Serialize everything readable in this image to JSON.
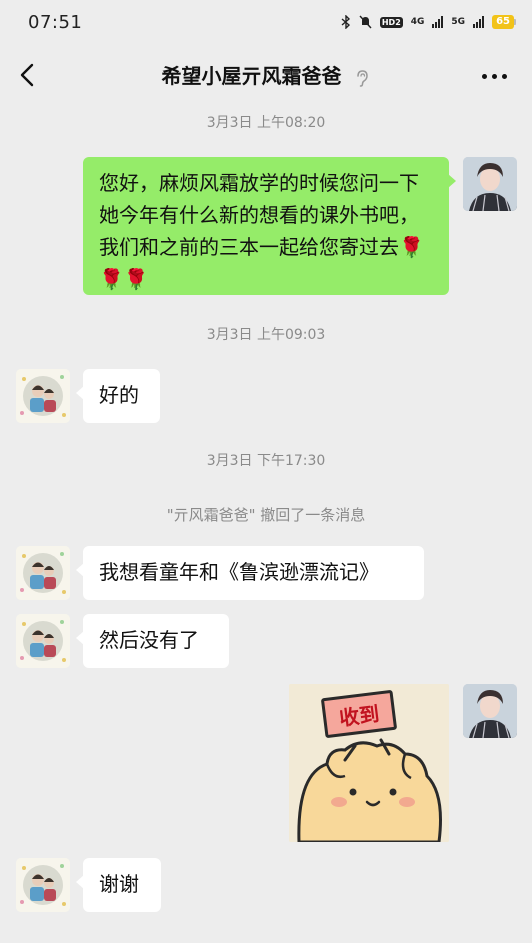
{
  "status_bar": {
    "time": "07:51",
    "network_hd": "HD2",
    "net1": "4G",
    "net2": "5G",
    "battery": "65"
  },
  "nav": {
    "title": "希望小屋亓风霜爸爸"
  },
  "messages": {
    "ts1": "3月3日 上午08:20",
    "msg1": "您好，麻烦风霜放学的时候您问一下她今年有什么新的想看的课外书吧，我们和之前的三本一起给您寄过去🌹🌹🌹",
    "ts2": "3月3日 上午09:03",
    "msg2": "好的",
    "ts3": "3月3日 下午17:30",
    "recall": "\"亓风霜爸爸\" 撤回了一条消息",
    "msg3": "我想看童年和《鲁滨逊漂流记》",
    "msg4": "然后没有了",
    "sticker_text": "收到",
    "msg5": "谢谢"
  },
  "colors": {
    "bg": "#ededed",
    "bubble_self": "#95ec69",
    "bubble_other": "#ffffff"
  }
}
